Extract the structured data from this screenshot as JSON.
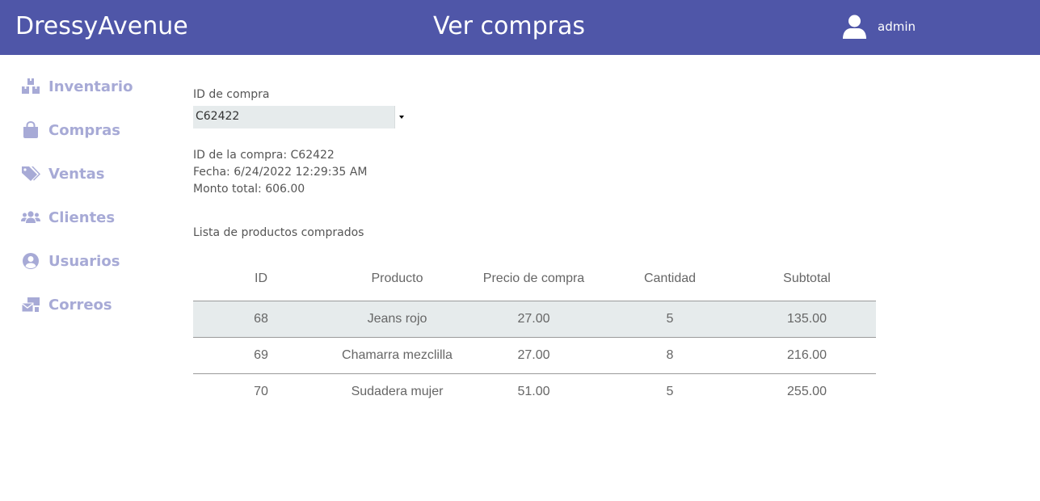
{
  "header": {
    "brand": "DressyAvenue",
    "title": "Ver compras",
    "user_icon": "user-icon",
    "username": "admin",
    "bg_color": "#4f56a8"
  },
  "sidebar": {
    "items": [
      {
        "label": "Inventario",
        "icon": "boxes-icon"
      },
      {
        "label": "Compras",
        "icon": "shopping-bag-icon"
      },
      {
        "label": "Ventas",
        "icon": "tags-icon"
      },
      {
        "label": "Clientes",
        "icon": "users-icon"
      },
      {
        "label": "Usuarios",
        "icon": "user-circle-icon"
      },
      {
        "label": "Correos",
        "icon": "mail-bulk-icon"
      }
    ],
    "color": "#a7aad6"
  },
  "main": {
    "select_label": "ID de compra",
    "select_value": "C62422",
    "info": {
      "purchase_id": "ID de la compra: C62422",
      "date": "Fecha: 6/24/2022 12:29:35 AM",
      "total": "Monto total: 606.00"
    },
    "list_title": "Lista de productos comprados",
    "table": {
      "columns": [
        "ID",
        "Producto",
        "Precio de compra",
        "Cantidad",
        "Subtotal"
      ],
      "rows": [
        [
          "68",
          "Jeans rojo",
          "27.00",
          "5",
          "135.00"
        ],
        [
          "69",
          "Chamarra mezclilla",
          "27.00",
          "8",
          "216.00"
        ],
        [
          "70",
          "Sudadera mujer",
          "51.00",
          "5",
          "255.00"
        ]
      ]
    }
  }
}
